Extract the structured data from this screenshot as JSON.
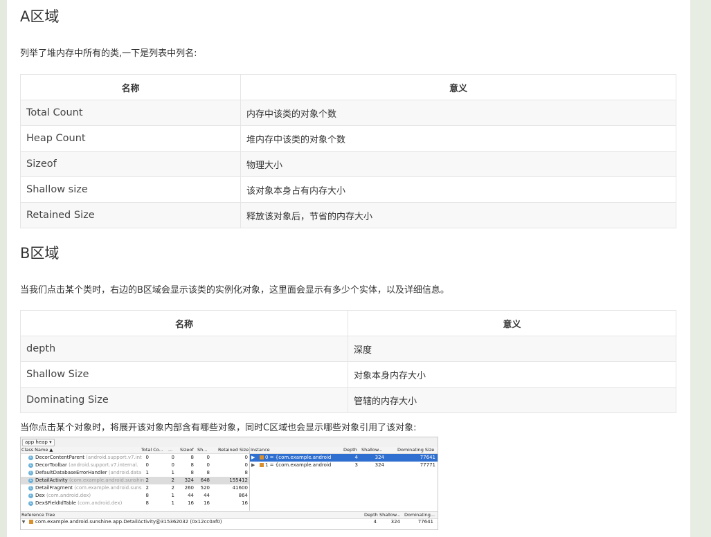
{
  "section_a": {
    "title": "A区域",
    "intro": "列举了堆内存中所有的类,一下是列表中列名:",
    "headers": [
      "名称",
      "意义"
    ],
    "rows": [
      {
        "name": "Total Count",
        "meaning": "内存中该类的对象个数"
      },
      {
        "name": "Heap Count",
        "meaning": "堆内存中该类的对象个数"
      },
      {
        "name": "Sizeof",
        "meaning": "物理大小"
      },
      {
        "name": "Shallow size",
        "meaning": "该对象本身占有内存大小"
      },
      {
        "name": "Retained Size",
        "meaning": "释放该对象后，节省的内存大小"
      }
    ]
  },
  "section_b": {
    "title": "B区域",
    "intro": "当我们点击某个类时，右边的B区域会显示该类的实例化对象，这里面会显示有多少个实体，以及详细信息。",
    "headers": [
      "名称",
      "意义"
    ],
    "rows": [
      {
        "name": "depth",
        "meaning": "深度"
      },
      {
        "name": "Shallow Size",
        "meaning": "对象本身内存大小"
      },
      {
        "name": "Dominating Size",
        "meaning": "管辖的内存大小"
      }
    ],
    "outro": "当你点击某个对象时，将展开该对象内部含有哪些对象，同时C区域也会显示哪些对象引用了该对象:"
  },
  "ide": {
    "heap_selector": "app heap ▾",
    "class_headers": {
      "class_name": "Class Name ▲",
      "total": "Total Co...",
      "heap": "...",
      "sizeof": "Sizeof",
      "shallow": "Sh...",
      "retained": "Retained Size"
    },
    "classes": [
      {
        "name": "DecorContentParent",
        "pkg": "(android.support.v7.int",
        "total": "0",
        "heap": "0",
        "sizeof": "8",
        "shallow": "0",
        "retained": "0"
      },
      {
        "name": "DecorToolbar",
        "pkg": "(android.support.v7.internal.",
        "total": "0",
        "heap": "0",
        "sizeof": "8",
        "shallow": "0",
        "retained": "0"
      },
      {
        "name": "DefaultDatabaseErrorHandler",
        "pkg": "(android.data",
        "total": "1",
        "heap": "1",
        "sizeof": "8",
        "shallow": "8",
        "retained": "8"
      },
      {
        "name": "DetailActivity",
        "pkg": "(com.example.android.sunshin",
        "total": "2",
        "heap": "2",
        "sizeof": "324",
        "shallow": "648",
        "retained": "155412"
      },
      {
        "name": "DetailFragment",
        "pkg": "(com.example.android.suns",
        "total": "2",
        "heap": "2",
        "sizeof": "260",
        "shallow": "520",
        "retained": "41600"
      },
      {
        "name": "Dex",
        "pkg": "(com.android.dex)",
        "total": "8",
        "heap": "1",
        "sizeof": "44",
        "shallow": "44",
        "retained": "864"
      },
      {
        "name": "Dex$FieldIdTable",
        "pkg": "(com.android.dex)",
        "total": "8",
        "heap": "1",
        "sizeof": "16",
        "shallow": "16",
        "retained": "16"
      }
    ],
    "instance_headers": {
      "instance": "Instance",
      "depth": "Depth",
      "shallow": "Shallow...",
      "dominating": "Dominating Size"
    },
    "instances": [
      {
        "label": "0 = {com.example.android",
        "depth": "4",
        "shallow": "324",
        "dominating": "77641"
      },
      {
        "label": "1 = {com.example.android",
        "depth": "3",
        "shallow": "324",
        "dominating": "77771"
      }
    ],
    "ref_headers": {
      "title": "Reference Tree",
      "depth": "Depth",
      "shallow": "Shallow...",
      "dominating": "Dominating..."
    },
    "ref_row": {
      "label": "com.example.android.sunshine.app.DetailActivity@315362032 (0x12cc0af0)",
      "depth": "4",
      "shallow": "324",
      "dominating": "77641"
    }
  }
}
